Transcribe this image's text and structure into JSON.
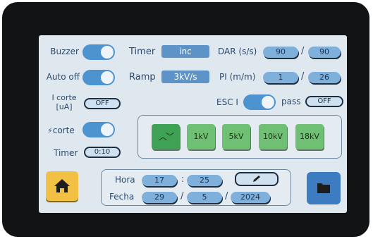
{
  "settings": {
    "buzzer_label": "Buzzer",
    "auto_off_label": "Auto off",
    "i_corte_label_line1": "I corte",
    "i_corte_label_line2": "[uA]",
    "i_corte_value": "OFF",
    "corte_label": "corte",
    "timer_label": "Timer",
    "timer_value": "0:10"
  },
  "mid": {
    "timer_label": "Timer",
    "timer_value": "inc",
    "ramp_label": "Ramp",
    "ramp_value": "3kV/s"
  },
  "right": {
    "dar_label": "DAR (s/s)",
    "dar_value_1": "90",
    "dar_value_2": "90",
    "pi_label": "PI (m/m)",
    "pi_value_1": "1",
    "pi_value_2": "26",
    "esc_label": "ESC I",
    "pass_label": "pass",
    "pass_value": "OFF",
    "separator": "/"
  },
  "voltage_buttons": [
    "1kV",
    "5kV",
    "10kV",
    "18kV"
  ],
  "datetime": {
    "hora_label": "Hora",
    "hour": "17",
    "colon": ":",
    "minute": "25",
    "fecha_label": "Fecha",
    "day": "29",
    "month": "5",
    "year": "2024",
    "separator": "/"
  },
  "colors": {
    "toggle_on": "#4d93cf",
    "voltage_button": "#6fc074",
    "home_button": "#f2c143",
    "folder_button": "#3d7cc0"
  },
  "icons": {
    "home": "home-icon",
    "folder": "folder-icon",
    "edit": "pencil-icon",
    "lightning": "lightning-icon",
    "chevron": "chevron-up-down-icon"
  }
}
